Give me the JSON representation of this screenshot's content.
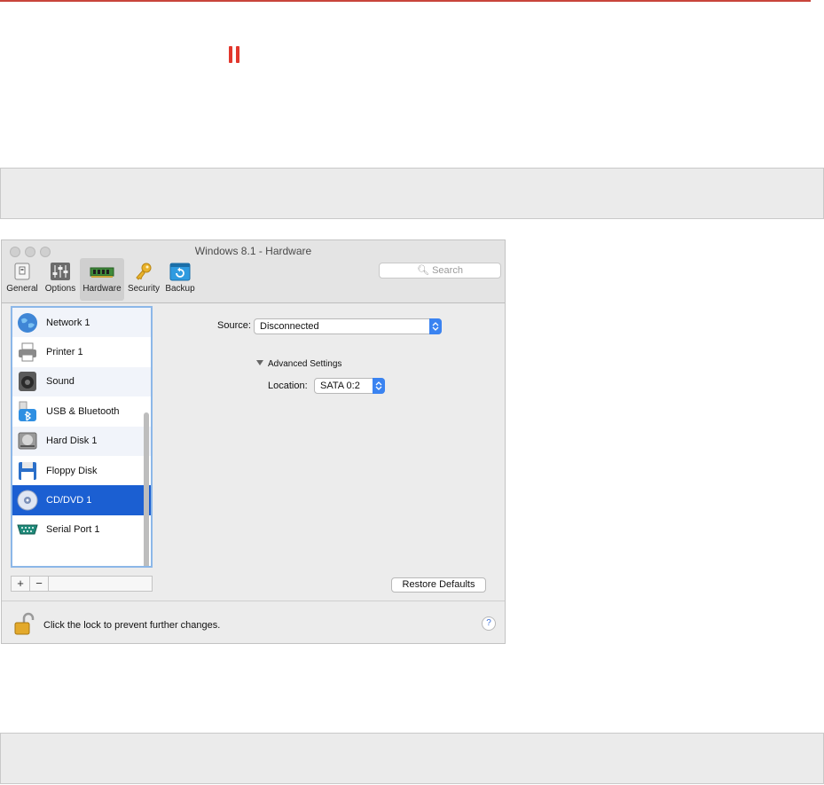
{
  "window": {
    "title": "Windows 8.1 - Hardware",
    "toolbar": [
      {
        "label": "General",
        "icon": "general-icon"
      },
      {
        "label": "Options",
        "icon": "options-sliders-icon"
      },
      {
        "label": "Hardware",
        "icon": "hardware-chip-icon",
        "active": true
      },
      {
        "label": "Security",
        "icon": "key-icon"
      },
      {
        "label": "Backup",
        "icon": "backup-icon"
      }
    ],
    "search_placeholder": "Search"
  },
  "devices": [
    {
      "label": "Network 1",
      "icon": "globe-icon"
    },
    {
      "label": "Printer 1",
      "icon": "printer-icon"
    },
    {
      "label": "Sound",
      "icon": "speaker-icon"
    },
    {
      "label": "USB & Bluetooth",
      "icon": "usb-bluetooth-icon"
    },
    {
      "label": "Hard Disk 1",
      "icon": "hard-disk-icon"
    },
    {
      "label": "Floppy Disk",
      "icon": "floppy-disk-icon"
    },
    {
      "label": "CD/DVD 1",
      "icon": "cd-dvd-icon",
      "selected": true
    },
    {
      "label": "Serial Port 1",
      "icon": "serial-port-icon"
    }
  ],
  "list_buttons": {
    "add": "+",
    "remove": "−"
  },
  "settings": {
    "source_label": "Source:",
    "source_value": "Disconnected",
    "advanced_label": "Advanced Settings",
    "location_label": "Location:",
    "location_value": "SATA 0:2",
    "restore_label": "Restore Defaults"
  },
  "footer": {
    "lock_text": "Click the lock to prevent further changes.",
    "help_label": "?"
  },
  "colors": {
    "accent": "#1b5fd2",
    "rule": "#c8453b",
    "pause": "#e2372d"
  }
}
